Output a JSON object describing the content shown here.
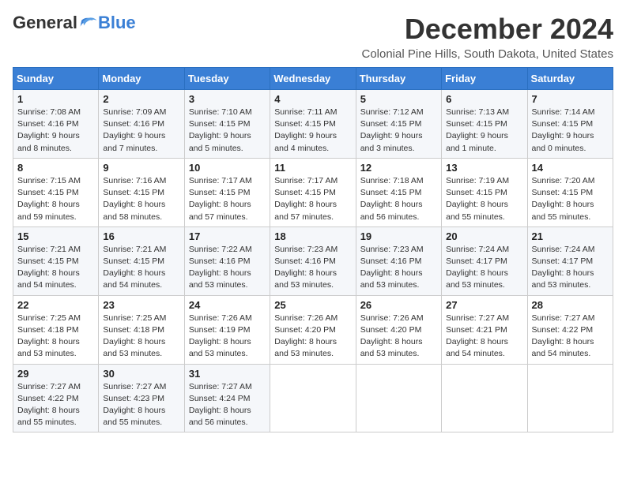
{
  "header": {
    "logo_general": "General",
    "logo_blue": "Blue",
    "month_title": "December 2024",
    "location": "Colonial Pine Hills, South Dakota, United States"
  },
  "weekdays": [
    "Sunday",
    "Monday",
    "Tuesday",
    "Wednesday",
    "Thursday",
    "Friday",
    "Saturday"
  ],
  "weeks": [
    [
      {
        "day": "1",
        "sunrise": "7:08 AM",
        "sunset": "4:16 PM",
        "daylight": "9 hours and 8 minutes."
      },
      {
        "day": "2",
        "sunrise": "7:09 AM",
        "sunset": "4:16 PM",
        "daylight": "9 hours and 7 minutes."
      },
      {
        "day": "3",
        "sunrise": "7:10 AM",
        "sunset": "4:15 PM",
        "daylight": "9 hours and 5 minutes."
      },
      {
        "day": "4",
        "sunrise": "7:11 AM",
        "sunset": "4:15 PM",
        "daylight": "9 hours and 4 minutes."
      },
      {
        "day": "5",
        "sunrise": "7:12 AM",
        "sunset": "4:15 PM",
        "daylight": "9 hours and 3 minutes."
      },
      {
        "day": "6",
        "sunrise": "7:13 AM",
        "sunset": "4:15 PM",
        "daylight": "9 hours and 1 minute."
      },
      {
        "day": "7",
        "sunrise": "7:14 AM",
        "sunset": "4:15 PM",
        "daylight": "9 hours and 0 minutes."
      }
    ],
    [
      {
        "day": "8",
        "sunrise": "7:15 AM",
        "sunset": "4:15 PM",
        "daylight": "8 hours and 59 minutes."
      },
      {
        "day": "9",
        "sunrise": "7:16 AM",
        "sunset": "4:15 PM",
        "daylight": "8 hours and 58 minutes."
      },
      {
        "day": "10",
        "sunrise": "7:17 AM",
        "sunset": "4:15 PM",
        "daylight": "8 hours and 57 minutes."
      },
      {
        "day": "11",
        "sunrise": "7:17 AM",
        "sunset": "4:15 PM",
        "daylight": "8 hours and 57 minutes."
      },
      {
        "day": "12",
        "sunrise": "7:18 AM",
        "sunset": "4:15 PM",
        "daylight": "8 hours and 56 minutes."
      },
      {
        "day": "13",
        "sunrise": "7:19 AM",
        "sunset": "4:15 PM",
        "daylight": "8 hours and 55 minutes."
      },
      {
        "day": "14",
        "sunrise": "7:20 AM",
        "sunset": "4:15 PM",
        "daylight": "8 hours and 55 minutes."
      }
    ],
    [
      {
        "day": "15",
        "sunrise": "7:21 AM",
        "sunset": "4:15 PM",
        "daylight": "8 hours and 54 minutes."
      },
      {
        "day": "16",
        "sunrise": "7:21 AM",
        "sunset": "4:15 PM",
        "daylight": "8 hours and 54 minutes."
      },
      {
        "day": "17",
        "sunrise": "7:22 AM",
        "sunset": "4:16 PM",
        "daylight": "8 hours and 53 minutes."
      },
      {
        "day": "18",
        "sunrise": "7:23 AM",
        "sunset": "4:16 PM",
        "daylight": "8 hours and 53 minutes."
      },
      {
        "day": "19",
        "sunrise": "7:23 AM",
        "sunset": "4:16 PM",
        "daylight": "8 hours and 53 minutes."
      },
      {
        "day": "20",
        "sunrise": "7:24 AM",
        "sunset": "4:17 PM",
        "daylight": "8 hours and 53 minutes."
      },
      {
        "day": "21",
        "sunrise": "7:24 AM",
        "sunset": "4:17 PM",
        "daylight": "8 hours and 53 minutes."
      }
    ],
    [
      {
        "day": "22",
        "sunrise": "7:25 AM",
        "sunset": "4:18 PM",
        "daylight": "8 hours and 53 minutes."
      },
      {
        "day": "23",
        "sunrise": "7:25 AM",
        "sunset": "4:18 PM",
        "daylight": "8 hours and 53 minutes."
      },
      {
        "day": "24",
        "sunrise": "7:26 AM",
        "sunset": "4:19 PM",
        "daylight": "8 hours and 53 minutes."
      },
      {
        "day": "25",
        "sunrise": "7:26 AM",
        "sunset": "4:20 PM",
        "daylight": "8 hours and 53 minutes."
      },
      {
        "day": "26",
        "sunrise": "7:26 AM",
        "sunset": "4:20 PM",
        "daylight": "8 hours and 53 minutes."
      },
      {
        "day": "27",
        "sunrise": "7:27 AM",
        "sunset": "4:21 PM",
        "daylight": "8 hours and 54 minutes."
      },
      {
        "day": "28",
        "sunrise": "7:27 AM",
        "sunset": "4:22 PM",
        "daylight": "8 hours and 54 minutes."
      }
    ],
    [
      {
        "day": "29",
        "sunrise": "7:27 AM",
        "sunset": "4:22 PM",
        "daylight": "8 hours and 55 minutes."
      },
      {
        "day": "30",
        "sunrise": "7:27 AM",
        "sunset": "4:23 PM",
        "daylight": "8 hours and 55 minutes."
      },
      {
        "day": "31",
        "sunrise": "7:27 AM",
        "sunset": "4:24 PM",
        "daylight": "8 hours and 56 minutes."
      },
      null,
      null,
      null,
      null
    ]
  ]
}
